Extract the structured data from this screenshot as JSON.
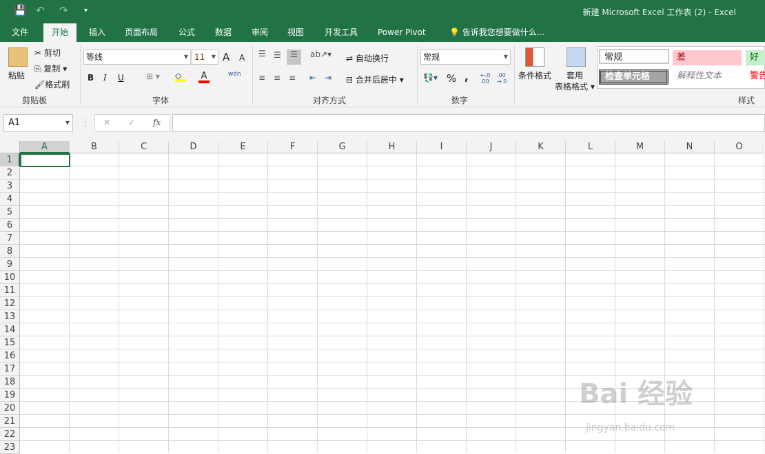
{
  "window": {
    "title": "新建 Microsoft Excel 工作表 (2) - Excel"
  },
  "qat": {
    "save": "💾",
    "undo": "↶",
    "redo": "↷",
    "more": "▾"
  },
  "tabs": [
    {
      "label": "文件"
    },
    {
      "label": "开始",
      "active": true
    },
    {
      "label": "插入"
    },
    {
      "label": "页面布局"
    },
    {
      "label": "公式"
    },
    {
      "label": "数据"
    },
    {
      "label": "审阅"
    },
    {
      "label": "视图"
    },
    {
      "label": "开发工具"
    },
    {
      "label": "Power Pivot"
    },
    {
      "label": "告诉我您想要做什么..."
    }
  ],
  "clipboard": {
    "paste": "粘贴",
    "cut": "剪切",
    "copy": "复制",
    "format_painter": "格式刷",
    "label": "剪贴板"
  },
  "font": {
    "name": "等线",
    "size": "11",
    "bold": "B",
    "italic": "I",
    "underline": "U",
    "grow": "A",
    "shrink": "A",
    "phonetic": "wén",
    "label": "字体",
    "highlight_color": "#ffff00",
    "font_color": "#ff0000"
  },
  "alignment": {
    "wrap": "自动换行",
    "merge": "合并后居中",
    "label": "对齐方式"
  },
  "number": {
    "format": "常规",
    "percent": "%",
    "comma": ",",
    "inc": "←.0 .00",
    "dec": ".00 →.0",
    "label": "数字"
  },
  "styles": {
    "conditional": "条件格式",
    "table_format_1": "套用",
    "table_format_2": "表格格式",
    "normal": "常规",
    "bad": "差",
    "good": "好",
    "check_cell": "检查单元格",
    "explanatory": "解释性文本",
    "warning": "警告",
    "label": "样式"
  },
  "formula_bar": {
    "name_box": "A1",
    "cancel": "✕",
    "enter": "✓",
    "fx": "fx",
    "value": ""
  },
  "columns": [
    "A",
    "B",
    "C",
    "D",
    "E",
    "F",
    "G",
    "H",
    "I",
    "J",
    "K",
    "L",
    "M",
    "N",
    "O"
  ],
  "rows": [
    "1",
    "2",
    "3",
    "4",
    "5",
    "6",
    "7",
    "8",
    "9",
    "10",
    "11",
    "12",
    "13",
    "14",
    "15",
    "16",
    "17",
    "18",
    "19",
    "20",
    "21",
    "22",
    "23"
  ],
  "watermark": {
    "text": "Bai 经验",
    "url": "jingyan.baidu.com"
  },
  "colors": {
    "accent": "#217346"
  }
}
